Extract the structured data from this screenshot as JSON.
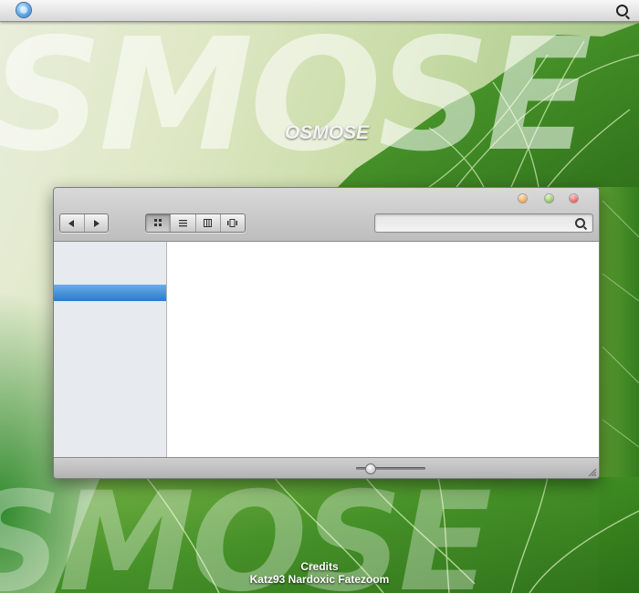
{
  "menubar": {
    "apple_icon": "apple-logo-icon",
    "spotlight_icon": "spotlight-search-icon"
  },
  "wallpaper": {
    "big_text": "SMOSE",
    "big_text_bottom": "SMOSE",
    "logo_text": "OSMOSE",
    "credits_title": "Credits",
    "credits_names": "Katz93 Nardoxic Fatezoom"
  },
  "window": {
    "traffic_lights": {
      "minimize_color": "#e38a1c",
      "zoom_color": "#5fad26",
      "close_color": "#d8322b"
    },
    "nav": {
      "back_icon": "back-arrow-icon",
      "forward_icon": "forward-arrow-icon"
    },
    "view_modes": [
      "icon-view",
      "list-view",
      "column-view",
      "cover-flow-view"
    ],
    "active_view": "icon-view",
    "search": {
      "value": "",
      "placeholder": ""
    },
    "sidebar": {
      "selected_color": "#2d79cc"
    },
    "zoom_slider": {
      "value": 0.2
    }
  }
}
